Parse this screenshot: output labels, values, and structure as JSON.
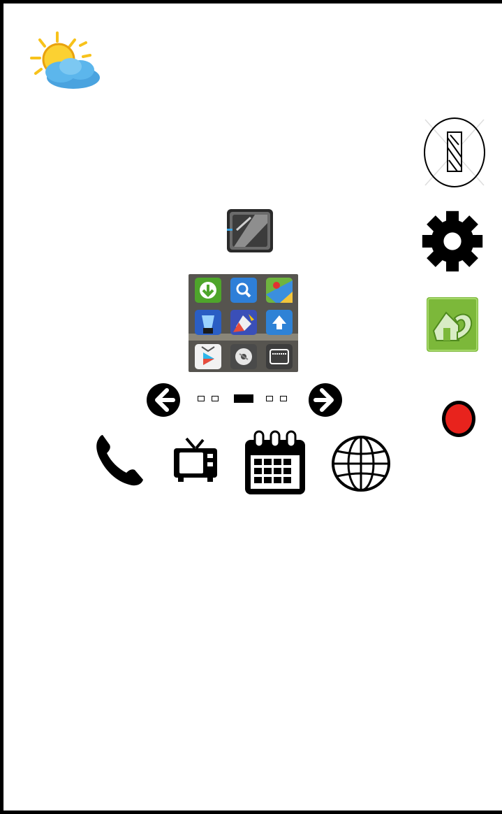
{
  "weather": {
    "icon": "sun-cloud-icon"
  },
  "side_icons": [
    {
      "name": "disabled-indicator-icon"
    },
    {
      "name": "gear-icon"
    },
    {
      "name": "android-app-icon"
    },
    {
      "name": "record-icon",
      "color": "#e8231d"
    }
  ],
  "center": {
    "top_app": {
      "icon": "camera-app-icon"
    },
    "app_grid": [
      "download-icon",
      "search-icon",
      "maps-icon",
      "flashlight-icon",
      "paint-icon",
      "upload-icon",
      "play-store-icon",
      "disc-icon",
      "keyboard-icon"
    ]
  },
  "pager": {
    "page_count": 5,
    "active_page": 3
  },
  "dock": [
    "phone-icon",
    "tv-icon",
    "calendar-icon",
    "globe-icon"
  ],
  "colors": {
    "background": "#ffffff",
    "frame": "#000000",
    "record": "#e8231d",
    "android_green": "#7cb83a"
  }
}
